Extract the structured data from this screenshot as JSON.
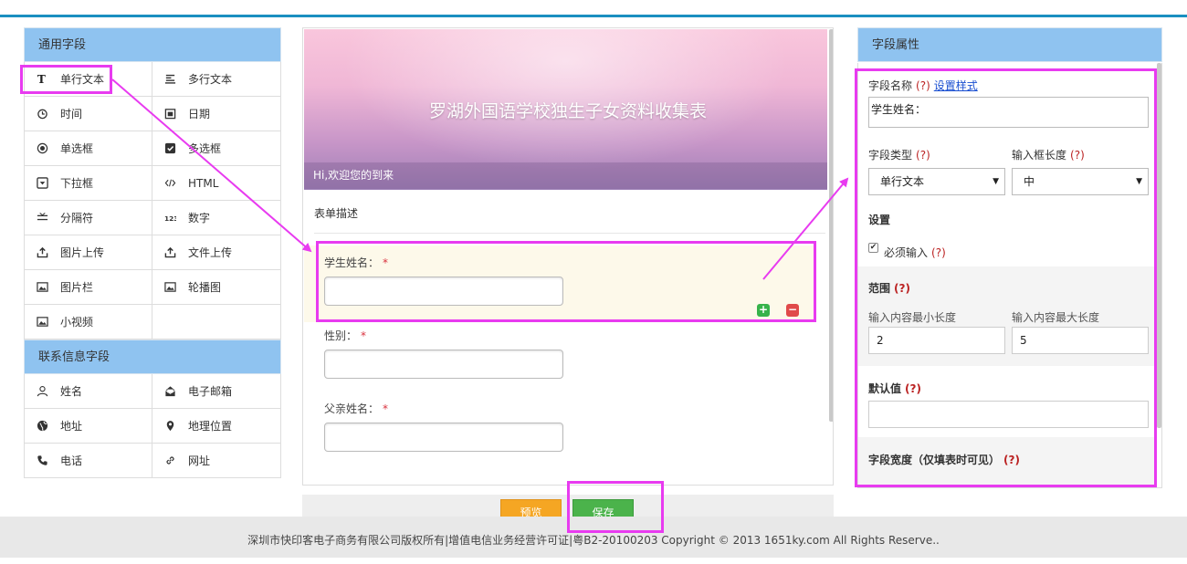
{
  "left": {
    "general_title": "通用字段",
    "general_fields": [
      {
        "icon": "text-t-icon",
        "label": "单行文本"
      },
      {
        "icon": "multiline-text-icon",
        "label": "多行文本"
      },
      {
        "icon": "clock-icon",
        "label": "时间"
      },
      {
        "icon": "calendar-icon",
        "label": "日期"
      },
      {
        "icon": "radio-icon",
        "label": "单选框"
      },
      {
        "icon": "checkbox-icon",
        "label": "多选框"
      },
      {
        "icon": "dropdown-icon",
        "label": "下拉框"
      },
      {
        "icon": "code-icon",
        "label": "HTML"
      },
      {
        "icon": "divider-icon",
        "label": "分隔符"
      },
      {
        "icon": "number-icon",
        "label": "数字"
      },
      {
        "icon": "upload-icon",
        "label": "图片上传"
      },
      {
        "icon": "upload-icon",
        "label": "文件上传"
      },
      {
        "icon": "image-icon",
        "label": "图片栏"
      },
      {
        "icon": "image-icon",
        "label": "轮播图"
      },
      {
        "icon": "image-icon",
        "label": "小视频"
      }
    ],
    "contact_title": "联系信息字段",
    "contact_fields": [
      {
        "icon": "user-icon",
        "label": "姓名"
      },
      {
        "icon": "mail-icon",
        "label": "电子邮箱"
      },
      {
        "icon": "globe-icon",
        "label": "地址"
      },
      {
        "icon": "map-pin-icon",
        "label": "地理位置"
      },
      {
        "icon": "phone-icon",
        "label": "电话"
      },
      {
        "icon": "link-icon",
        "label": "网址"
      }
    ]
  },
  "form": {
    "banner_title": "罗湖外国语学校独生子女资料收集表",
    "welcome": "Hi,欢迎您的到来",
    "description": "表单描述",
    "fields": [
      {
        "label": "学生姓名：",
        "required": "*",
        "value": ""
      },
      {
        "label": "性别：",
        "required": "*",
        "value": ""
      },
      {
        "label": "父亲姓名：",
        "required": "*",
        "value": ""
      }
    ],
    "add_symbol": "+",
    "remove_symbol": "−"
  },
  "actions": {
    "preview": "预览",
    "save": "保存"
  },
  "footer": "深圳市快印客电子商务有限公司版权所有|增值电信业务经营许可证|粤B2-20100203 Copyright © 2013 1651ky.com All Rights Reserve..",
  "props": {
    "title": "字段属性",
    "name_label": "字段名称",
    "help": "(?)",
    "style_link": "设置样式",
    "name_value": "学生姓名：",
    "type_label": "字段类型",
    "type_value": "单行文本",
    "length_label": "输入框长度",
    "length_value": "中",
    "settings_label": "设置",
    "required_label": "必须输入",
    "range_label": "范围",
    "min_label": "输入内容最小长度",
    "min_value": "2",
    "max_label": "输入内容最大长度",
    "max_value": "5",
    "default_label": "默认值",
    "default_value": "",
    "width_label": "字段宽度（仅填表时可见）",
    "check_mark": "✔",
    "select_arrow": "▼"
  },
  "colors": {
    "accent_blue": "#1a8fc0",
    "section_header": "#8fc3f0",
    "highlight": "#e83bf0",
    "preview_button": "#f5a623",
    "save_button": "#4bb34b"
  }
}
